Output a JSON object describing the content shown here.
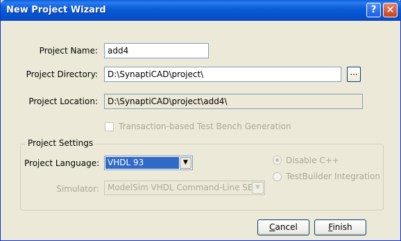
{
  "window": {
    "title": "New Project Wizard",
    "help_button": "?",
    "close_button": "✕"
  },
  "project_name": {
    "label": "Project Name:",
    "value": "add4"
  },
  "project_directory": {
    "label": "Project Directory:",
    "value": "D:\\SynaptiCAD\\project\\",
    "browse_label": "..."
  },
  "project_location": {
    "label": "Project Location:",
    "value": "D:\\SynaptiCAD\\project\\add4\\"
  },
  "transaction_checkbox": {
    "label": "Transaction-based Test Bench Generation",
    "checked": false,
    "enabled": false
  },
  "settings": {
    "group_title": "Project Settings",
    "language": {
      "label": "Project Language:",
      "value": "VHDL 93"
    },
    "simulator": {
      "label": "Simulator:",
      "value": "ModelSim VHDL Command-Line SE",
      "enabled": false
    },
    "radio_disable_cpp": {
      "label": "Disable C++",
      "selected": true,
      "enabled": false
    },
    "radio_testbuilder": {
      "label": "TestBuilder Integration",
      "selected": false,
      "enabled": false
    }
  },
  "buttons": {
    "cancel_mnemonic": "C",
    "cancel_rest": "ancel",
    "finish_mnemonic": "F",
    "finish_rest": "inish"
  }
}
